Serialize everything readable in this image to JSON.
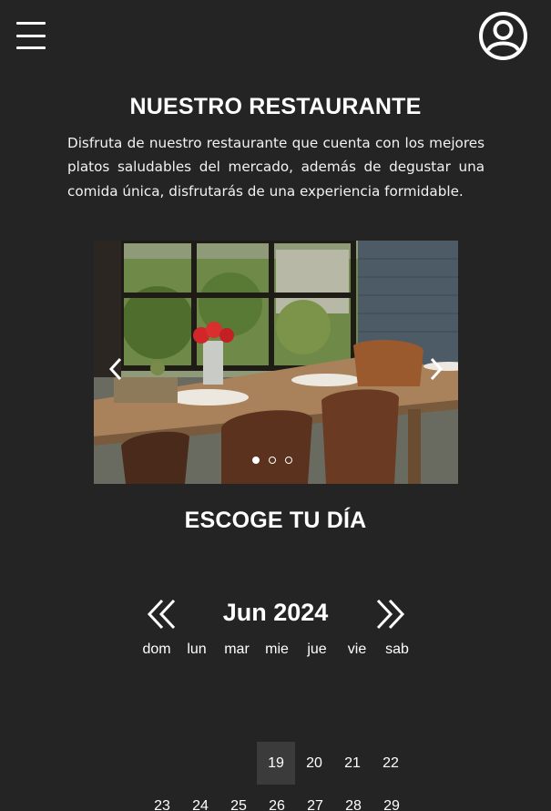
{
  "header": {
    "menu_icon": "hamburger-menu-icon",
    "user_icon": "user-account-icon"
  },
  "restaurant": {
    "title": "NUESTRO RESTAURANTE",
    "description": "Disfruta de nuestro restaurante que cuenta con los mejores platos saludables del mercado, además de degustar una comida única, disfrutarás de una experiencia formidable."
  },
  "carousel": {
    "prev_icon": "chevron-left-icon",
    "next_icon": "chevron-right-icon",
    "slide_count": 3,
    "active_slide": 1
  },
  "calendar": {
    "title": "ESCOGE TU DÍA",
    "month_label": "Jun 2024",
    "prev_icon": "double-chevron-left-icon",
    "next_icon": "double-chevron-right-icon",
    "weekdays": [
      "dom",
      "lun",
      "mar",
      "mie",
      "jue",
      "vie",
      "sab"
    ],
    "week1": [
      "19",
      "20",
      "21",
      "22"
    ],
    "week2": [
      "23",
      "24",
      "25",
      "26",
      "27",
      "28",
      "29"
    ],
    "selected_day": "19"
  },
  "colors": {
    "background": "#242424",
    "text": "#ffffff",
    "selected_day_bg": "#3b3b3b"
  }
}
